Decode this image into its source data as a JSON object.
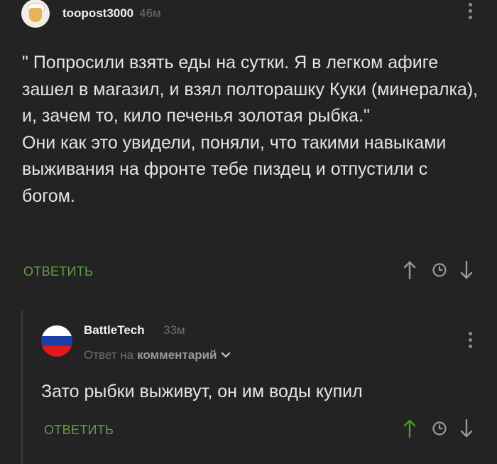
{
  "comment": {
    "username": "toopost3000",
    "time": "46м",
    "paragraphs": [
      "\" Попросили взять еды на сутки. Я в легком афиге зашел в магазил, и взял полторашку Куки (минералка), и, зачем то, кило печенья золотая рыбка.\"",
      "Они как это увидели, поняли, что такими навыками выживания на фронте тебе пиздец и отпустили с богом."
    ],
    "reply_label": "ОТВЕТИТЬ",
    "upvote_color": "#9a9a9a"
  },
  "reply": {
    "username": "BattleTech",
    "time": "33м",
    "answer_to_prefix": "Ответ на",
    "answer_to_link": "комментарий",
    "text": "Зато рыбки выживут, он им воды купил",
    "reply_label": "ОТВЕТИТЬ",
    "upvote_color": "#4c9a2a"
  },
  "colors": {
    "background": "#232323",
    "accent_green": "#5da046",
    "flag": [
      "#ffffff",
      "#1c3faa",
      "#e4181c"
    ]
  },
  "icons": [
    "kebab-menu-icon",
    "arrow-up-icon",
    "clock-icon",
    "arrow-down-icon",
    "chevron-down-icon"
  ]
}
